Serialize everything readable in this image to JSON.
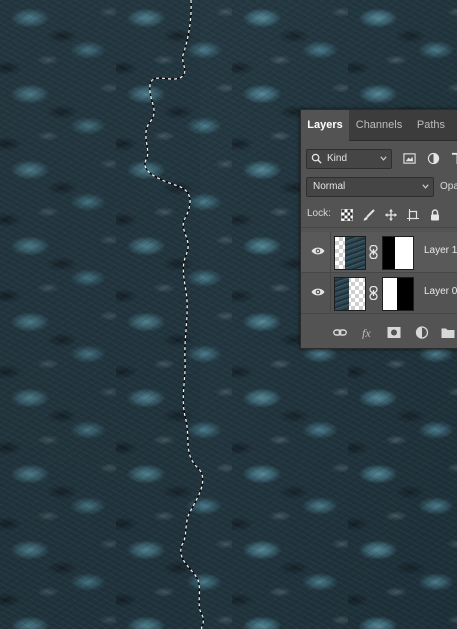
{
  "panel": {
    "tabs": [
      {
        "label": "Layers",
        "active": true
      },
      {
        "label": "Channels",
        "active": false
      },
      {
        "label": "Paths",
        "active": false
      }
    ],
    "filter": {
      "kind_label": "Kind",
      "icons": [
        "search-icon",
        "image-filter-icon",
        "adjustment-filter-icon",
        "type-filter-icon"
      ]
    },
    "blend": {
      "mode_label": "Normal",
      "opacity_label": "Opa"
    },
    "lock": {
      "label": "Lock:",
      "icons": [
        "lock-transparent-pixels-icon",
        "lock-image-pixels-icon",
        "lock-position-icon",
        "lock-artboard-icon",
        "lock-all-icon"
      ]
    },
    "layers": [
      {
        "name": "Layer 1",
        "visible": true,
        "selected": true,
        "has_mask": true
      },
      {
        "name": "Layer 0",
        "visible": true,
        "selected": false,
        "has_mask": true
      }
    ],
    "bottom_icons": [
      "link-layers-icon",
      "fx-icon",
      "add-mask-icon",
      "adjustment-layer-icon",
      "new-group-icon"
    ]
  },
  "colors": {
    "panel_bg": "#535353",
    "tab_bar_bg": "#3c3c3c",
    "fabric_teal": "#5f96a5",
    "fabric_dark": "#213640"
  }
}
